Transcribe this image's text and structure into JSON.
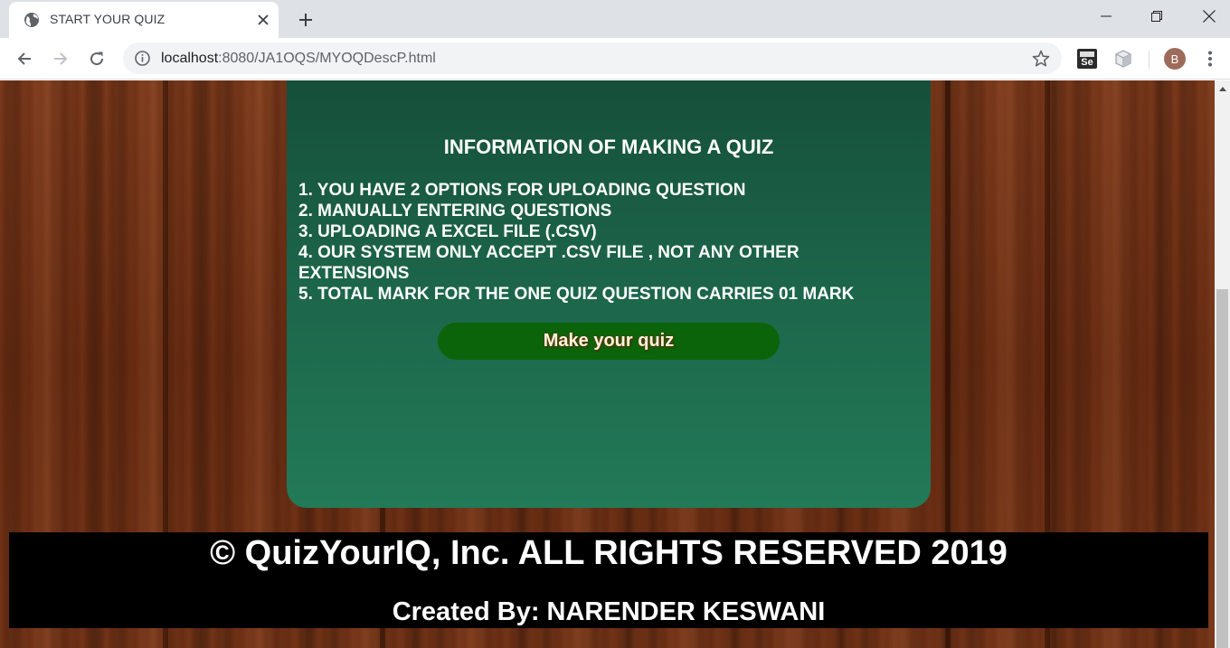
{
  "browser": {
    "tab_title": "START YOUR QUIZ",
    "url_host": "localhost",
    "url_rest": ":8080/JA1OQS/MYOQDescP.html",
    "profile_initial": "B",
    "extension_se_label": "Se"
  },
  "card": {
    "title": "INFORMATION OF MAKING A QUIZ",
    "items": [
      "1. YOU HAVE 2 OPTIONS FOR UPLOADING QUESTION",
      "2. MANUALLY ENTERING QUESTIONS",
      "3. UPLOADING A EXCEL FILE (.CSV)",
      "4. OUR SYSTEM ONLY ACCEPT .CSV FILE , NOT ANY OTHER EXTENSIONS",
      "5. TOTAL MARK FOR THE ONE QUIZ QUESTION CARRIES 01 MARK"
    ],
    "button_label": "Make your quiz"
  },
  "footer": {
    "copyright": "© QuizYourIQ, Inc. ALL RIGHTS RESERVED 2019",
    "created_by": "Created By: NARENDER KESWANI"
  },
  "colors": {
    "card_top": "#154f3a",
    "card_bottom": "#227a58",
    "button_bg": "#0b6409",
    "footer_bg": "#000000",
    "wood": "#6a2e14"
  }
}
